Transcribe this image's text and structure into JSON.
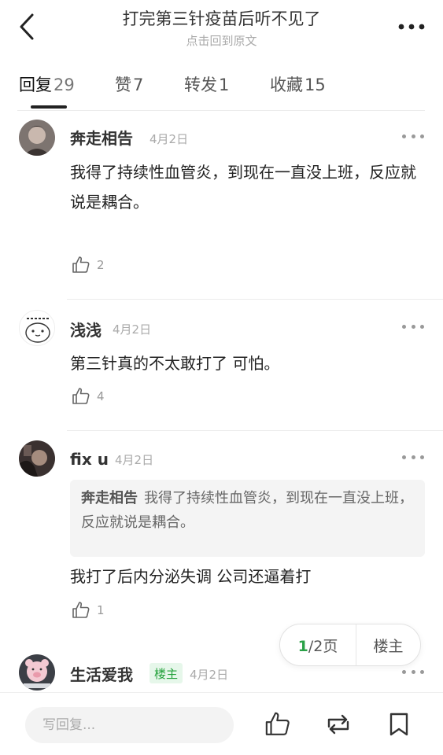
{
  "header": {
    "title": "打完第三针疫苗后听不见了",
    "subtitle": "点击回到原文"
  },
  "tabs": [
    {
      "label": "回复",
      "count": "29",
      "active": true
    },
    {
      "label": "赞",
      "count": "7"
    },
    {
      "label": "转发",
      "count": "1"
    },
    {
      "label": "收藏",
      "count": "15"
    }
  ],
  "comments": [
    {
      "name": "奔走相告",
      "date": "4月2日",
      "text": "我得了持续性血管炎，到现在一直没上班，反应就说是耦合。",
      "likes": "2"
    },
    {
      "name": "浅浅",
      "date": "4月2日",
      "text": "第三针真的不太敢打了  可怕。",
      "likes": "4"
    },
    {
      "name": "fix u",
      "date": "4月2日",
      "quote_name": "奔走相告",
      "quote_text": "我得了持续性血管炎，到现在一直没上班，反应就说是耦合。",
      "text": "我打了后内分泌失调 公司还逼着打",
      "likes": "1"
    },
    {
      "name": "生活爱我",
      "badge": "楼主",
      "date": "4月2日"
    }
  ],
  "pager": {
    "current": "1",
    "total_label": "/2页",
    "op_label": "楼主"
  },
  "bottom": {
    "reply_placeholder": "写回复..."
  },
  "icons": {
    "back": "chevron-left-icon",
    "more": "more-horizontal-icon",
    "like": "thumbs-up-icon",
    "repost": "repost-icon",
    "bookmark": "bookmark-icon"
  },
  "colors": {
    "accent_green": "#2aa147",
    "badge_bg": "#e6f7ea"
  }
}
